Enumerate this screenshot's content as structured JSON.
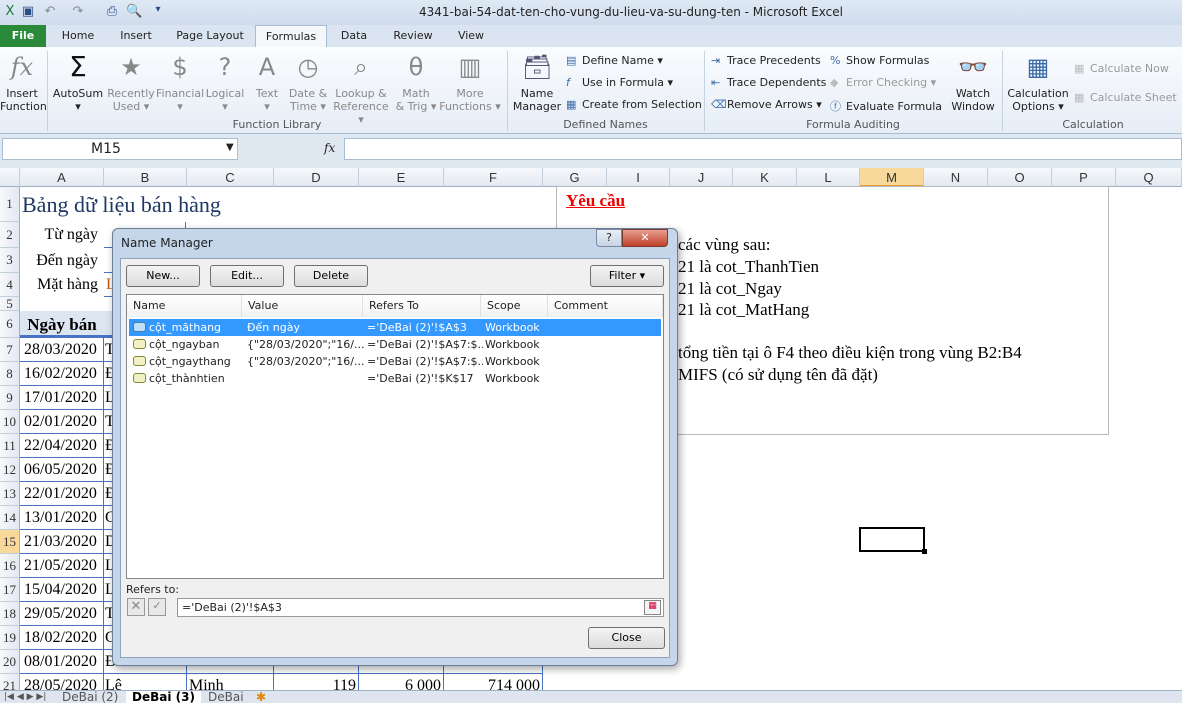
{
  "window": {
    "title": "4341-bai-54-dat-ten-cho-vung-du-lieu-va-su-dung-ten  -  Microsoft Excel"
  },
  "tabs": [
    "File",
    "Home",
    "Insert",
    "Page Layout",
    "Formulas",
    "Data",
    "Review",
    "View"
  ],
  "ribbon": {
    "function_library": {
      "label": "Function Library",
      "buttons": [
        {
          "l1": "Insert",
          "l2": "Function",
          "icon": "fx"
        },
        {
          "l1": "AutoSum",
          "l2": "▾",
          "icon": "Σ"
        },
        {
          "l1": "Recently",
          "l2": "Used ▾",
          "icon": "★"
        },
        {
          "l1": "Financial",
          "l2": "▾",
          "icon": "$"
        },
        {
          "l1": "Logical",
          "l2": "▾",
          "icon": "?"
        },
        {
          "l1": "Text",
          "l2": "▾",
          "icon": "A"
        },
        {
          "l1": "Date &",
          "l2": "Time ▾",
          "icon": "◷"
        },
        {
          "l1": "Lookup &",
          "l2": "Reference ▾",
          "icon": "⌕"
        },
        {
          "l1": "Math",
          "l2": "& Trig ▾",
          "icon": "θ"
        },
        {
          "l1": "More",
          "l2": "Functions ▾",
          "icon": "▥"
        }
      ]
    },
    "defined_names": {
      "label": "Defined Names",
      "name_manager": [
        "Name",
        "Manager"
      ],
      "define_name": "Define Name ▾",
      "use_in_formula": "Use in Formula ▾",
      "create_from_selection": "Create from Selection"
    },
    "formula_auditing": {
      "label": "Formula Auditing",
      "trace_precedents": "Trace Precedents",
      "trace_dependents": "Trace Dependents",
      "remove_arrows": "Remove Arrows ▾",
      "show_formulas": "Show Formulas",
      "error_checking": "Error Checking ▾",
      "evaluate_formula": "Evaluate Formula",
      "watch_window": [
        "Watch",
        "Window"
      ]
    },
    "calculation": {
      "label": "Calculation",
      "options": [
        "Calculation",
        "Options ▾"
      ],
      "calculate_now": "Calculate Now",
      "calculate_sheet": "Calculate Sheet"
    }
  },
  "formula_bar": {
    "name_box": "M15",
    "fx": "fx",
    "value": ""
  },
  "columns": [
    "A",
    "B",
    "C",
    "D",
    "E",
    "F",
    "G",
    "I",
    "J",
    "K",
    "L",
    "M",
    "N",
    "O",
    "P",
    "Q"
  ],
  "rows": [
    "1",
    "2",
    "3",
    "4",
    "5",
    "6",
    "7",
    "8",
    "9",
    "10",
    "11",
    "12",
    "13",
    "14",
    "15",
    "16",
    "17",
    "18",
    "19",
    "20",
    "21"
  ],
  "sheet": {
    "title": "Bảng dữ liệu bán hàng",
    "labels": [
      "Từ ngày",
      "Đến ngày",
      "Mặt hàng"
    ],
    "mathang_partial": "L",
    "header_ngayban": "Ngày bán",
    "dates": [
      "28/03/2020",
      "16/02/2020",
      "17/01/2020",
      "02/01/2020",
      "22/04/2020",
      "06/05/2020",
      "22/01/2020",
      "13/01/2020",
      "21/03/2020",
      "21/05/2020",
      "15/04/2020",
      "29/05/2020",
      "18/02/2020",
      "08/01/2020",
      "28/05/2020"
    ],
    "b_partial": [
      "T",
      "Đ",
      "L",
      "T",
      "Đ",
      "Đ",
      "Đ",
      "C",
      "D",
      "L",
      "L",
      "T",
      "C",
      "Đỗ Văn"
    ],
    "row21": {
      "b": "Lê",
      "c": "Minh",
      "d": "119",
      "e": "6 000",
      "f": "714 000"
    }
  },
  "textbox": {
    "heading": "Yêu cầu",
    "lines": [
      "các vùng sau:",
      "21 là cot_ThanhTien",
      "21  là cot_Ngay",
      "21  là cot_MatHang",
      "tổng tiền tại ô F4 theo điều kiện trong vùng B2:B4",
      "MIFS (có sử dụng tên đã đặt)"
    ]
  },
  "dialog": {
    "title": "Name Manager",
    "help": "?",
    "close_x": "✕",
    "new": "New...",
    "edit": "Edit...",
    "delete": "Delete",
    "filter": "Filter ▾",
    "columns": [
      "Name",
      "Value",
      "Refers To",
      "Scope",
      "Comment"
    ],
    "names": [
      {
        "name": "cột_mãthang",
        "value": "Đến ngày",
        "refers": "='DeBai (2)'!$A$3",
        "scope": "Workbook",
        "comment": ""
      },
      {
        "name": "cột_ngayban",
        "value": "{\"28/03/2020\";\"16/...",
        "refers": "='DeBai (2)'!$A$7:$...",
        "scope": "Workbook",
        "comment": ""
      },
      {
        "name": "cột_ngaythang",
        "value": "{\"28/03/2020\";\"16/...",
        "refers": "='DeBai (2)'!$A$7:$...",
        "scope": "Workbook",
        "comment": ""
      },
      {
        "name": "cột_thànhtien",
        "value": "",
        "refers": "='DeBai (2)'!$K$17",
        "scope": "Workbook",
        "comment": ""
      }
    ],
    "refers_label": "Refers to:",
    "refers_value": "='DeBai (2)'!$A$3",
    "close": "Close"
  },
  "sheet_tabs": [
    "DeBai (2)",
    "DeBai (3)",
    "DeBai"
  ],
  "active_sheet": "DeBai (3)"
}
